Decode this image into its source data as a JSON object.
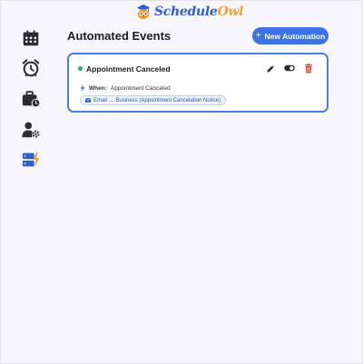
{
  "brand": {
    "name_part1": "Schedule",
    "name_part2": "Owl",
    "logo_icon": "owl-graduation-cap-icon",
    "colors": {
      "primary": "#2f5fd0",
      "accent": "#f0a330"
    }
  },
  "sidebar": {
    "items": [
      {
        "id": "calendar",
        "icon": "calendar-icon"
      },
      {
        "id": "reminders",
        "icon": "alarm-clock-icon"
      },
      {
        "id": "services",
        "icon": "briefcase-clock-icon"
      },
      {
        "id": "account",
        "icon": "user-gear-icon"
      },
      {
        "id": "automations",
        "icon": "server-bolt-icon",
        "active": true
      }
    ]
  },
  "header": {
    "title": "Automated Events",
    "new_button_icon": "+",
    "new_button_label": "New Automation"
  },
  "automations": [
    {
      "title": "Appointment Canceled",
      "status_color": "#27b04f",
      "when_label": "When:",
      "when_value": "Appointment Canceled",
      "action_label": "Email → Business (Appointment Cancelation Notice)",
      "actions": [
        "edit-icon",
        "toggle-icon",
        "delete-icon"
      ]
    }
  ],
  "theme": {
    "accent": "#3b73e6",
    "card_border": "#4a7fe0",
    "delete": "#e0443a"
  }
}
